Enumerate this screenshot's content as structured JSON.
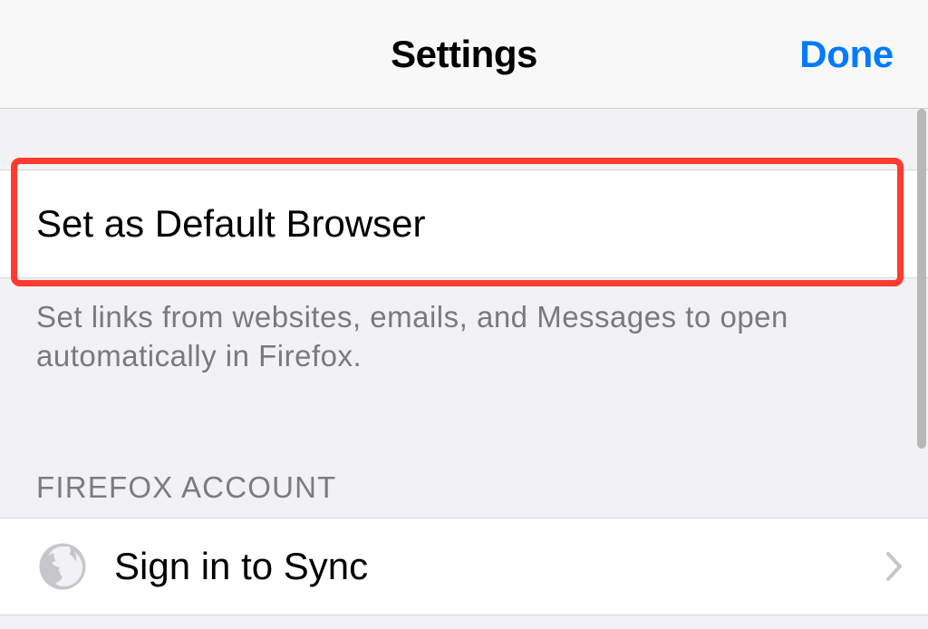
{
  "header": {
    "title": "Settings",
    "done_label": "Done"
  },
  "default_browser": {
    "row_label": "Set as Default Browser",
    "description": "Set links from websites, emails, and Messages to open automatically in Firefox."
  },
  "account_section": {
    "header": "FIREFOX ACCOUNT",
    "sync_label": "Sign in to Sync"
  }
}
